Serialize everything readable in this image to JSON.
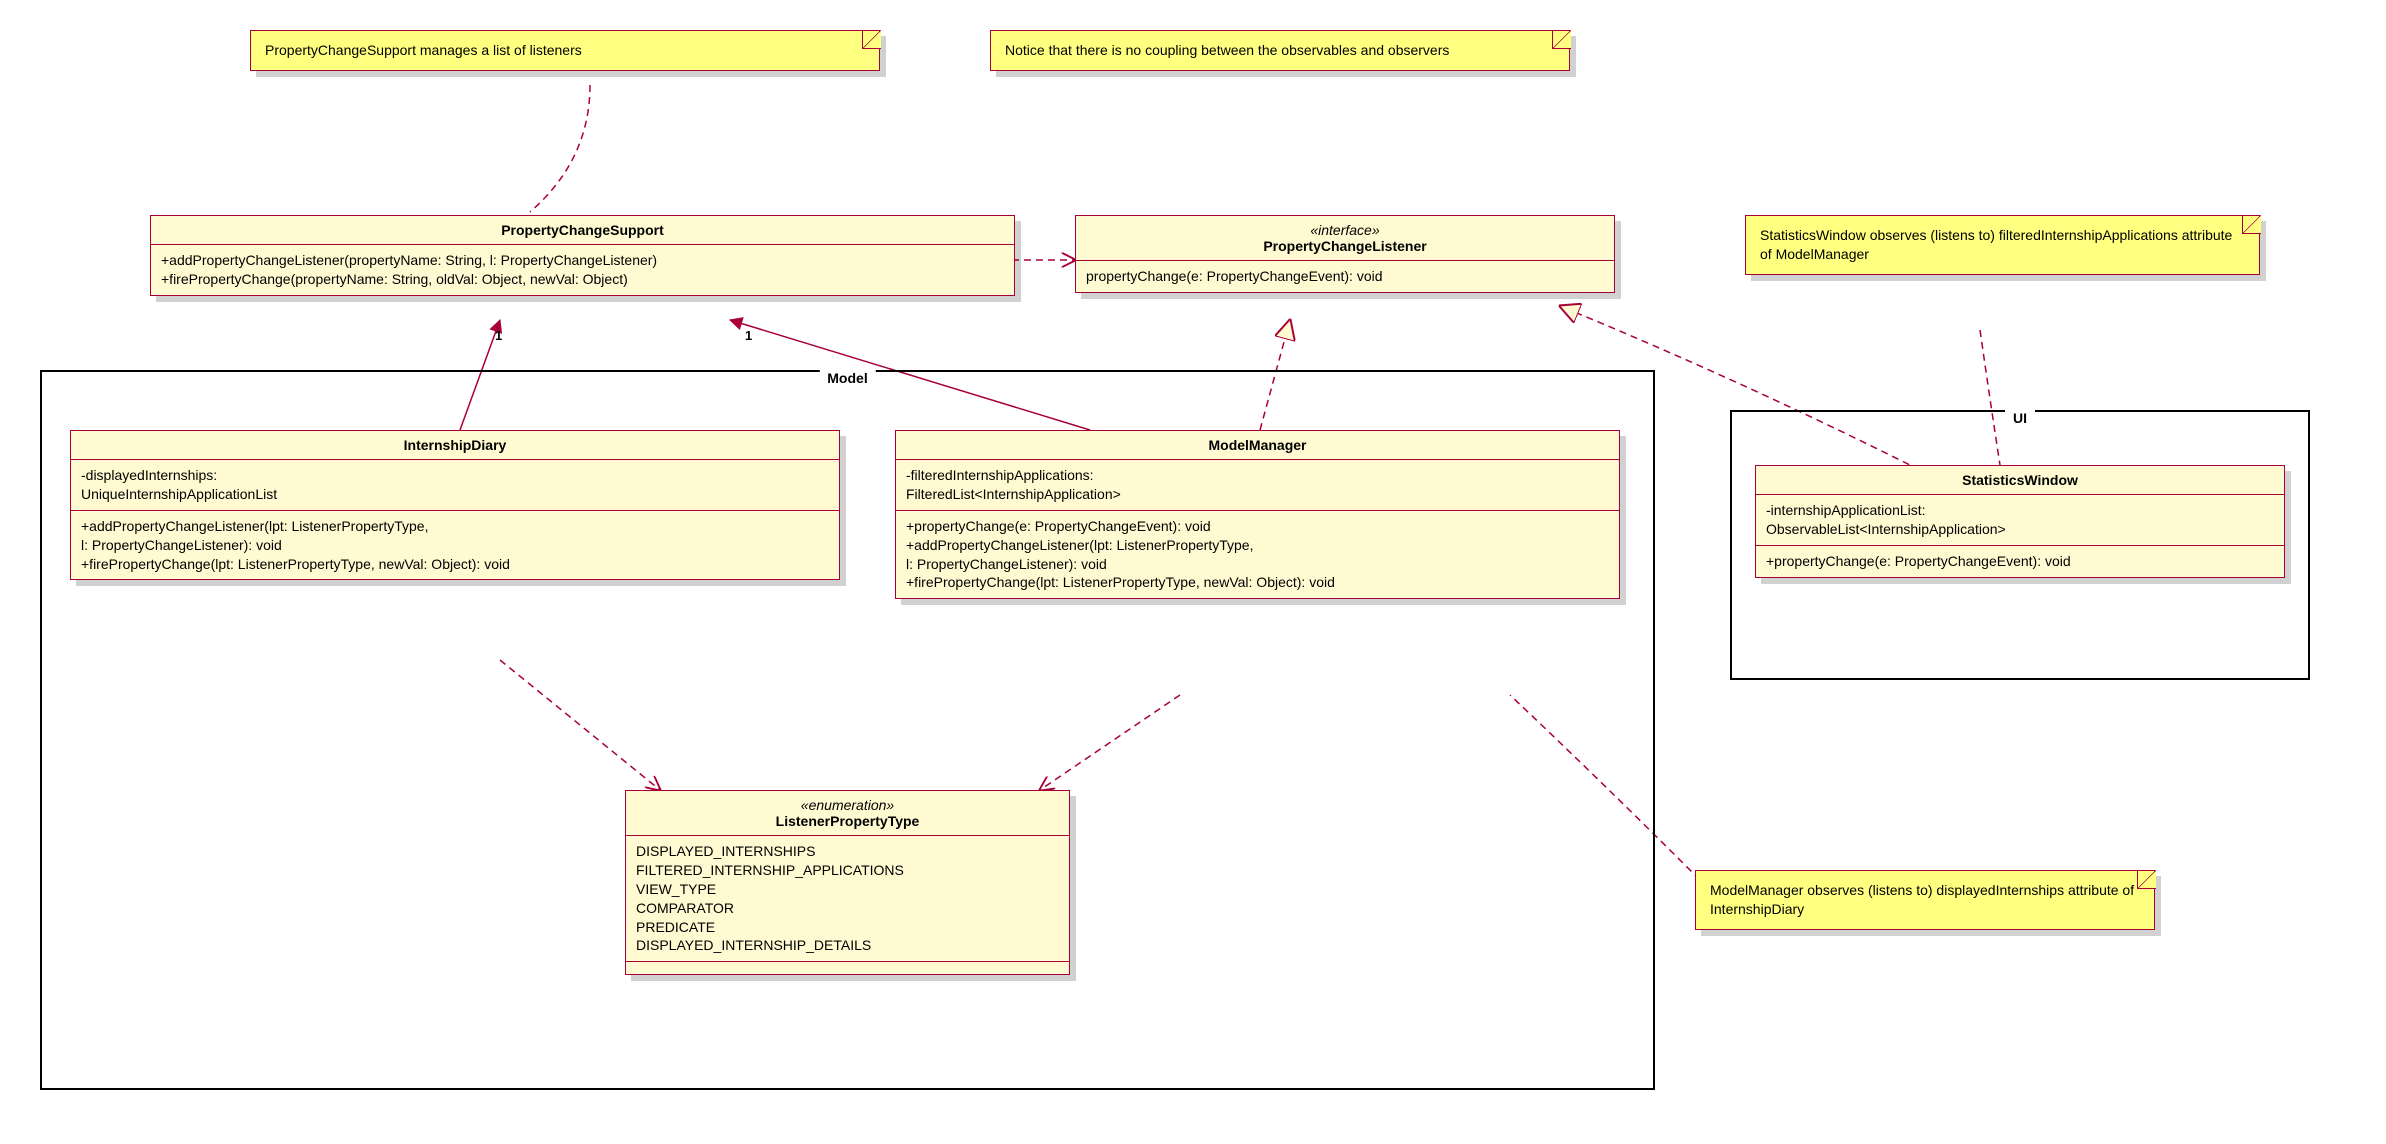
{
  "notes": {
    "n1": "PropertyChangeSupport manages a list of listeners",
    "n2": "Notice that there is no coupling between the\nobservables and observers",
    "n3": "StatisticsWindow observes (listens to)\nfilteredInternshipApplications attribute\nof ModelManager",
    "n4": "ModelManager observes (listens to)\ndisplayedInternships attribute\nof InternshipDiary"
  },
  "classes": {
    "pcs": {
      "name": "PropertyChangeSupport",
      "ops": "+addPropertyChangeListener(propertyName: String, l: PropertyChangeListener)\n+firePropertyChange(propertyName: String, oldVal: Object, newVal: Object)"
    },
    "pcl": {
      "stereo": "«interface»",
      "name": "PropertyChangeListener",
      "ops": "propertyChange(e: PropertyChangeEvent): void"
    },
    "diary": {
      "name": "InternshipDiary",
      "attrs": "-displayedInternships:\nUniqueInternshipApplicationList",
      "ops": "+addPropertyChangeListener(lpt: ListenerPropertyType,\nl: PropertyChangeListener): void\n+firePropertyChange(lpt: ListenerPropertyType, newVal: Object): void"
    },
    "mm": {
      "name": "ModelManager",
      "attrs": "-filteredInternshipApplications:\nFilteredList<InternshipApplication>",
      "ops": "+propertyChange(e: PropertyChangeEvent): void\n+addPropertyChangeListener(lpt: ListenerPropertyType,\nl: PropertyChangeListener): void\n+firePropertyChange(lpt: ListenerPropertyType, newVal: Object): void"
    },
    "enum": {
      "stereo": "«enumeration»",
      "name": "ListenerPropertyType",
      "literals": "DISPLAYED_INTERNSHIPS\nFILTERED_INTERNSHIP_APPLICATIONS\nVIEW_TYPE\nCOMPARATOR\nPREDICATE\nDISPLAYED_INTERNSHIP_DETAILS"
    },
    "sw": {
      "name": "StatisticsWindow",
      "attrs": "-internshipApplicationList:\nObservableList<InternshipApplication>",
      "ops": "+propertyChange(e: PropertyChangeEvent): void"
    }
  },
  "packages": {
    "model": "Model",
    "ui": "UI"
  },
  "mult": {
    "one_a": "1",
    "one_b": "1"
  }
}
